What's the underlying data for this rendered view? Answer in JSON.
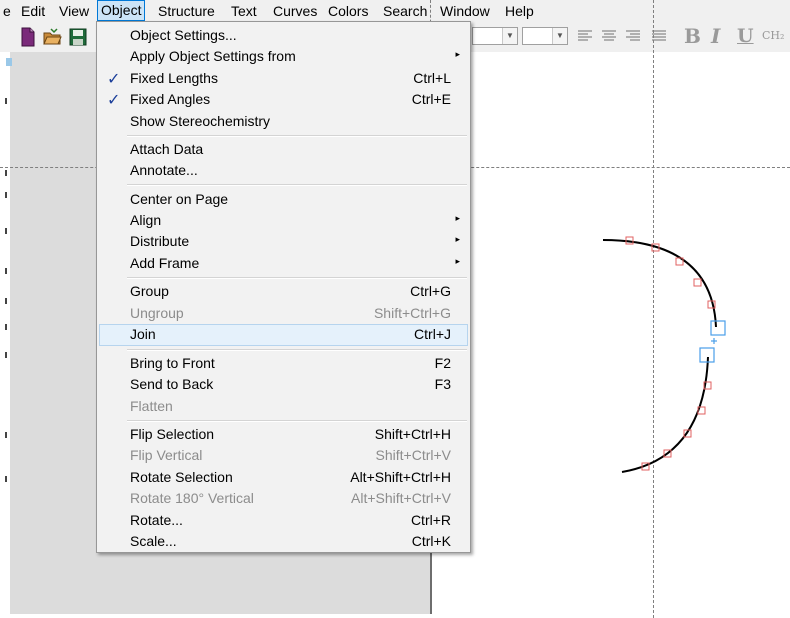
{
  "menubar": {
    "items": [
      "e",
      "Edit",
      "View",
      "Object",
      "Structure",
      "Text",
      "Curves",
      "Colors",
      "Search",
      "Window",
      "Help"
    ]
  },
  "toolbar": {
    "icons": [
      "new-document-icon",
      "open-folder-icon",
      "save-icon"
    ],
    "format": {
      "bold": "B",
      "italic": "I",
      "underline": "U",
      "formula": "CH₂"
    }
  },
  "object_menu": {
    "items": [
      {
        "label": "Object Settings...",
        "shortcut": ""
      },
      {
        "label": "Apply Object Settings from",
        "shortcut": "",
        "submenu": "▸"
      },
      {
        "label": "Fixed Lengths",
        "shortcut": "Ctrl+L",
        "check": "✓"
      },
      {
        "label": "Fixed Angles",
        "shortcut": "Ctrl+E",
        "check": "✓"
      },
      {
        "label": "Show Stereochemistry",
        "shortcut": ""
      },
      {
        "label": "Attach Data",
        "shortcut": ""
      },
      {
        "label": "Annotate...",
        "shortcut": ""
      },
      {
        "label": "Center on Page",
        "shortcut": ""
      },
      {
        "label": "Align",
        "shortcut": "",
        "submenu": "▸"
      },
      {
        "label": "Distribute",
        "shortcut": "",
        "submenu": "▸"
      },
      {
        "label": "Add Frame",
        "shortcut": "",
        "submenu": "▸"
      },
      {
        "label": "Group",
        "shortcut": "Ctrl+G"
      },
      {
        "label": "Ungroup",
        "shortcut": "Shift+Ctrl+G",
        "disabled": true
      },
      {
        "label": "Join",
        "shortcut": "Ctrl+J",
        "highlighted": true
      },
      {
        "label": "Bring to Front",
        "shortcut": "F2"
      },
      {
        "label": "Send to Back",
        "shortcut": "F3"
      },
      {
        "label": "Flatten",
        "shortcut": "",
        "disabled": true
      },
      {
        "label": "Flip Selection",
        "shortcut": "Shift+Ctrl+H"
      },
      {
        "label": "Flip Vertical",
        "shortcut": "Shift+Ctrl+V",
        "disabled": true
      },
      {
        "label": "Rotate Selection",
        "shortcut": "Alt+Shift+Ctrl+H"
      },
      {
        "label": "Rotate 180° Vertical",
        "shortcut": "Alt+Shift+Ctrl+V",
        "disabled": true
      },
      {
        "label": "Rotate...",
        "shortcut": "Ctrl+R"
      },
      {
        "label": "Scale...",
        "shortcut": "Ctrl+K"
      }
    ]
  },
  "colors": {
    "menu_highlight": "#cce4f7",
    "menu_highlight_border": "#0078d7",
    "check_mark": "#1c3f9a",
    "selection_handles": "#4a9ee8",
    "curve_points": "#e06060"
  }
}
